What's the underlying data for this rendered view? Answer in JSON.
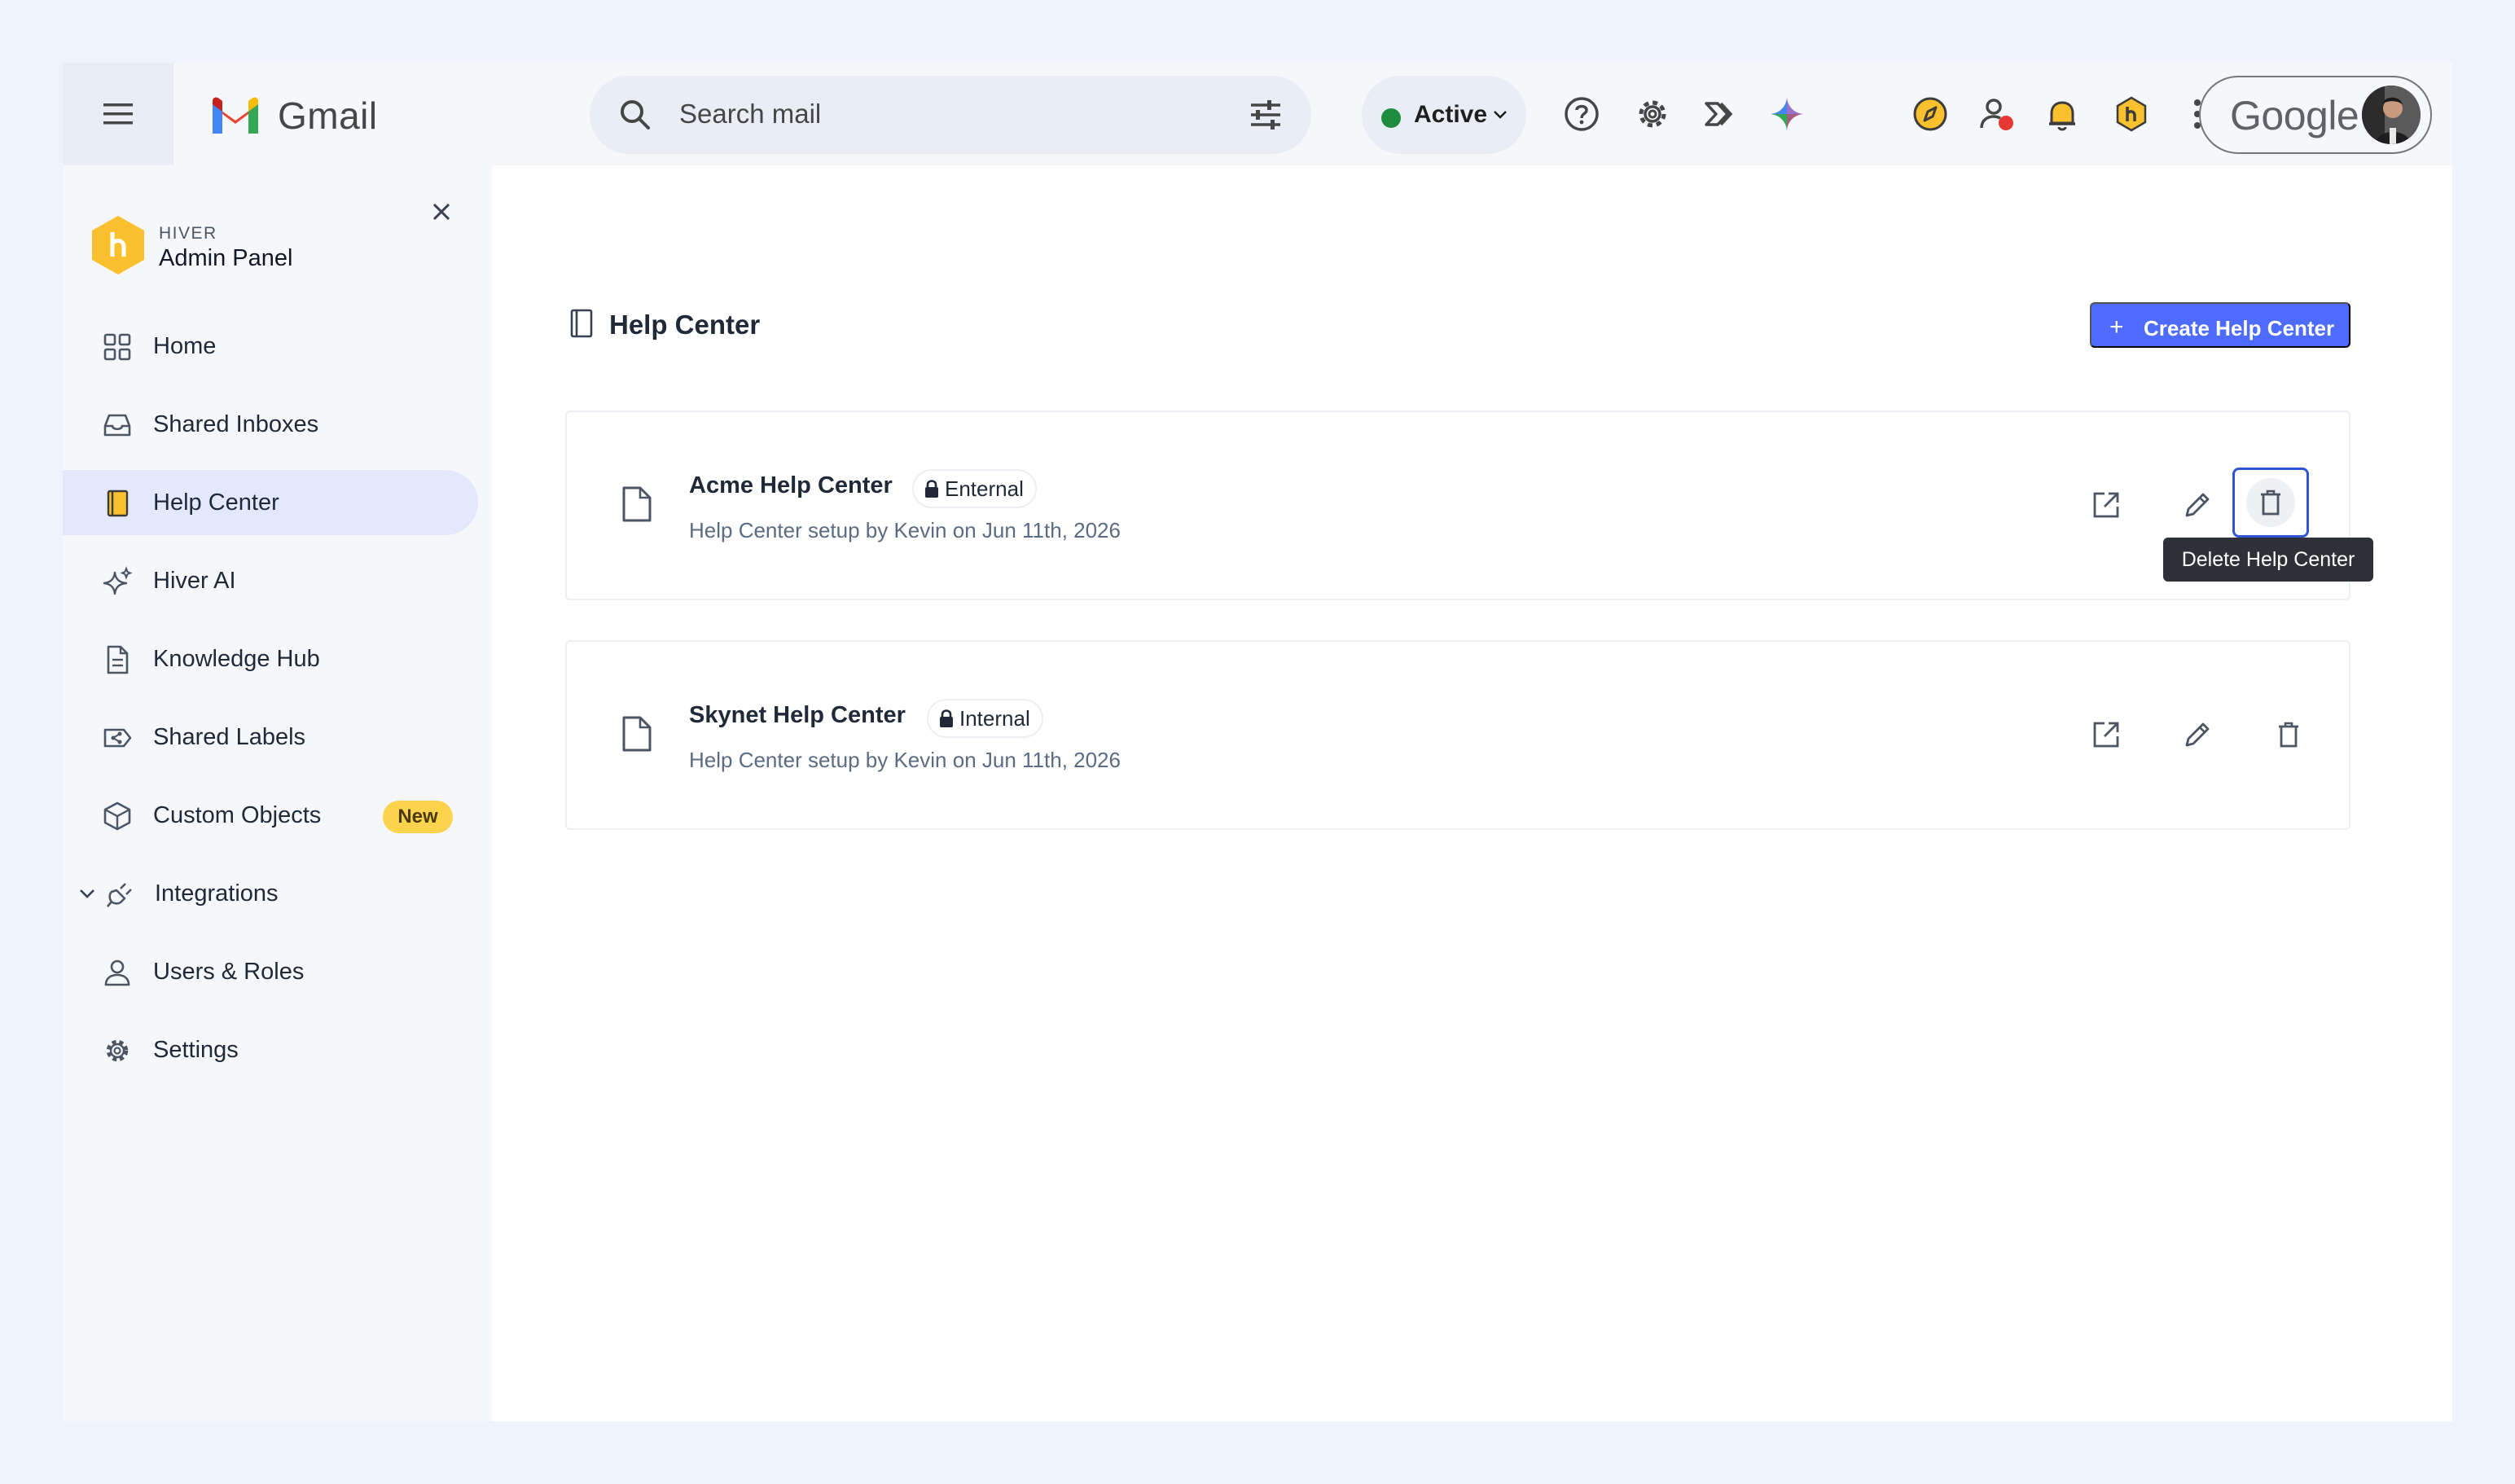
{
  "app": {
    "name": "Gmail",
    "search_placeholder": "Search mail",
    "status_label": "Active",
    "status_color": "#1e8e3e",
    "google_label": "Google",
    "top_icons": [
      "help-icon",
      "settings-icon",
      "hiver-arrows-icon",
      "gemini-icon",
      "compass-icon",
      "user-status-icon",
      "bell-icon",
      "hiver-logo-icon",
      "apps-grid-icon"
    ]
  },
  "sidebar": {
    "brand_sub": "HIVER",
    "brand_title": "Admin Panel",
    "items": [
      {
        "label": "Home",
        "icon": "grid-icon"
      },
      {
        "label": "Shared Inboxes",
        "icon": "inbox-icon"
      },
      {
        "label": "Help Center",
        "icon": "book-icon",
        "active": true
      },
      {
        "label": "Hiver AI",
        "icon": "sparkle-icon"
      },
      {
        "label": "Knowledge Hub",
        "icon": "document-icon"
      },
      {
        "label": "Shared Labels",
        "icon": "label-icon"
      },
      {
        "label": "Custom Objects",
        "icon": "cube-icon",
        "badge": "New"
      },
      {
        "label": "Integrations",
        "icon": "plug-icon",
        "expandable": true
      },
      {
        "label": "Users & Roles",
        "icon": "user-icon"
      },
      {
        "label": "Settings",
        "icon": "gear-icon"
      }
    ]
  },
  "main": {
    "title": "Help Center",
    "create_button": "Create Help Center",
    "cards": [
      {
        "title": "Acme Help Center",
        "tag": "Enternal",
        "subtitle": "Help Center setup by Kevin on Jun 11th, 2026"
      },
      {
        "title": "Skynet Help Center",
        "tag": "Internal",
        "subtitle": "Help Center setup by Kevin on Jun 11th, 2026"
      }
    ],
    "tooltip": "Delete Help Center"
  },
  "colors": {
    "accent": "#4d6bfe",
    "active_nav": "#e3e9fb",
    "badge": "#fcd34d",
    "focus_ring": "#2f55d4"
  }
}
